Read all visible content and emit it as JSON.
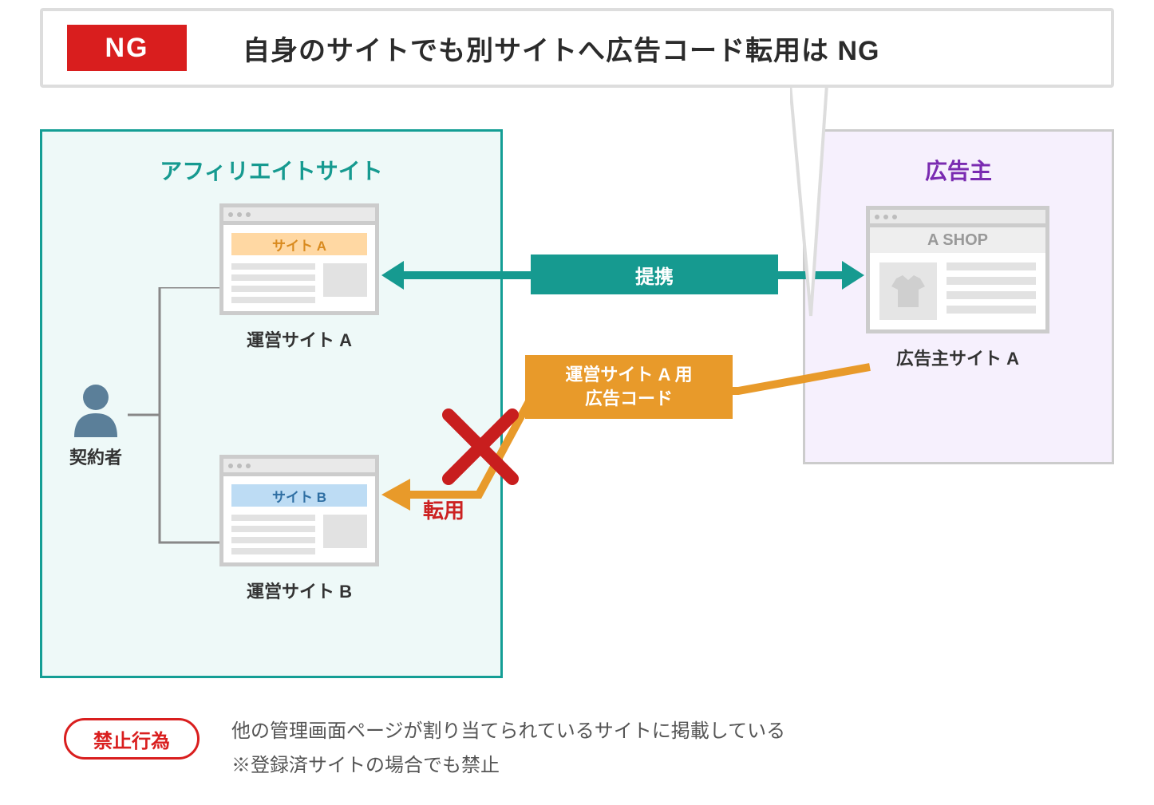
{
  "header": {
    "badge": "NG",
    "title": "自身のサイトでも別サイトへ広告コード転用は NG"
  },
  "affiliate": {
    "panel_title": "アフィリエイトサイト",
    "contractor_label": "契約者",
    "site_a": {
      "bar": "サイト A",
      "caption": "運営サイト A"
    },
    "site_b": {
      "bar": "サイト B",
      "caption": "運営サイト B"
    }
  },
  "advertiser": {
    "panel_title": "広告主",
    "shop": {
      "bar": "A SHOP",
      "caption": "広告主サイト A"
    }
  },
  "links": {
    "partnership": "提携",
    "adcode": "運営サイト A 用\n広告コード",
    "reuse": "転用"
  },
  "footer": {
    "pill": "禁止行為",
    "line1": "他の管理画面ページが割り当てられているサイトに掲載している",
    "line2": "※登録済サイトの場合でも禁止"
  },
  "colors": {
    "teal": "#169a90",
    "orange": "#e89a2a",
    "red": "#d91e1e",
    "purple": "#7a2bb1"
  }
}
